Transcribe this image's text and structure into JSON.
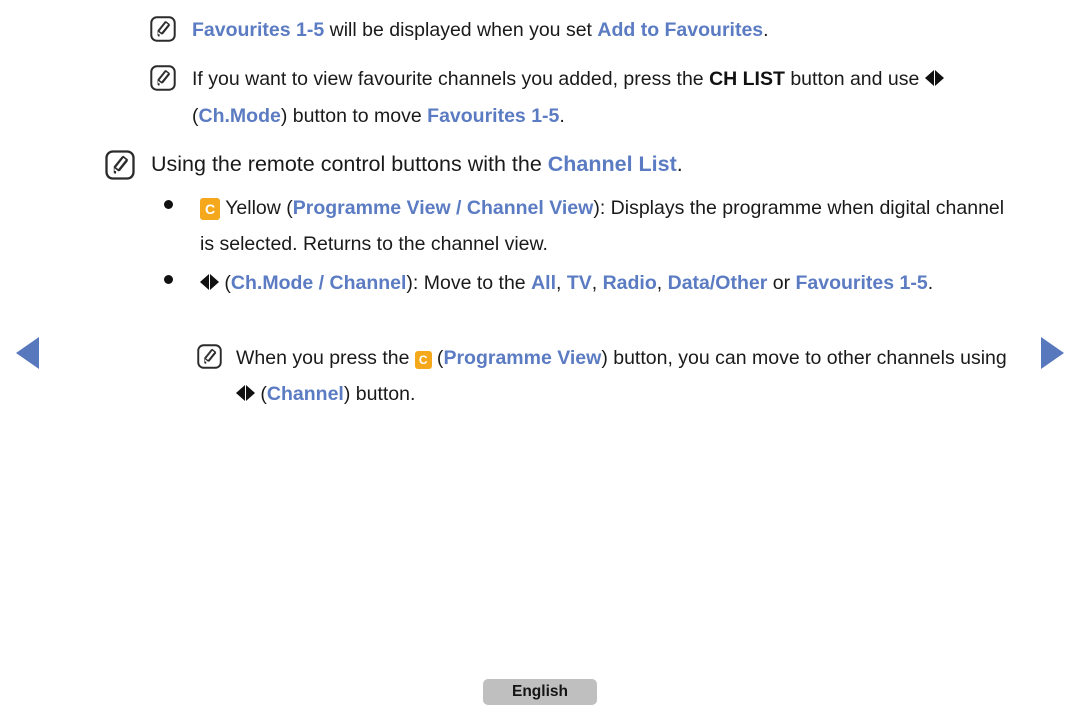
{
  "page": {
    "background": "#ffffff",
    "accent_blue": "#5B7BC2",
    "key_yellow": "#F5A81C",
    "nav_blue": "#5878BE",
    "button_grey": "#BFBFBF"
  },
  "nav": {
    "prev_label": "previous-page-arrow",
    "next_label": "next-page-arrow"
  },
  "notes": [
    {
      "icon": "note-icon",
      "segments": [
        {
          "text": "Favourites 1-5",
          "style": "blue"
        },
        {
          "text": " will be displayed when you set ",
          "style": "plain"
        },
        {
          "text": "Add to Favourites",
          "style": "blue"
        },
        {
          "text": ".",
          "style": "plain"
        }
      ]
    },
    {
      "icon": "note-icon",
      "segments": [
        {
          "text": "If you want to view favourite channels you added, press the ",
          "style": "plain"
        },
        {
          "text": "CH LIST",
          "style": "bold"
        },
        {
          "text": " button and use ",
          "style": "plain"
        },
        {
          "text": "◀▶",
          "style": "arrows"
        },
        {
          "text": " (",
          "style": "plain"
        },
        {
          "text": "Ch.Mode",
          "style": "blue"
        },
        {
          "text": ") button to move ",
          "style": "plain"
        },
        {
          "text": "Favourites 1-5",
          "style": "blue"
        },
        {
          "text": ".",
          "style": "plain"
        }
      ]
    }
  ],
  "heading": {
    "icon": "note-icon",
    "text_before": "Using the remote control buttons with the ",
    "highlight": "Channel List",
    "text_after": "."
  },
  "bullets": [
    {
      "marker": "bullet-dot",
      "badge": "C",
      "segments": [
        {
          "text": " Yellow (",
          "style": "plain"
        },
        {
          "text": "Programme View / Channel View",
          "style": "blue"
        },
        {
          "text": "): Displays the programme when digital channel is selected. Returns to the channel view.",
          "style": "plain"
        }
      ]
    },
    {
      "marker": "bullet-dot",
      "segments": [
        {
          "text": "◀▶",
          "style": "arrows"
        },
        {
          "text": " (",
          "style": "plain"
        },
        {
          "text": "Ch.Mode / Channel",
          "style": "blue"
        },
        {
          "text": "): Move to the ",
          "style": "plain"
        },
        {
          "text": "All",
          "style": "blue"
        },
        {
          "text": ", ",
          "style": "plain"
        },
        {
          "text": "TV",
          "style": "blue"
        },
        {
          "text": ", ",
          "style": "plain"
        },
        {
          "text": "Radio",
          "style": "blue"
        },
        {
          "text": ", ",
          "style": "plain"
        },
        {
          "text": "Data/Other",
          "style": "blue"
        },
        {
          "text": " or ",
          "style": "plain"
        },
        {
          "text": "Favourites 1-5",
          "style": "blue"
        },
        {
          "text": ".",
          "style": "plain"
        }
      ]
    }
  ],
  "subnote": {
    "icon": "note-icon",
    "badge": "C",
    "segments": [
      {
        "text": "When you press the ",
        "style": "plain"
      },
      {
        "text": "BADGE",
        "style": "badge"
      },
      {
        "text": " (",
        "style": "plain"
      },
      {
        "text": "Programme View",
        "style": "blue"
      },
      {
        "text": ") button, you can move to other channels using ",
        "style": "plain"
      },
      {
        "text": "◀▶",
        "style": "arrows"
      },
      {
        "text": " (",
        "style": "plain"
      },
      {
        "text": "Channel",
        "style": "blue"
      },
      {
        "text": ") button.",
        "style": "plain"
      }
    ]
  },
  "text": {
    "note1_part1": "Favourites 1-5",
    "note1_part2": " will be displayed when you set ",
    "note1_part3": "Add to Favourites",
    "note1_part4": ".",
    "note2_part1": "If you want to view favourite channels you added, press the ",
    "note2_part2": "CH LIST",
    "note2_part3": " button and use ",
    "note2_part4": " (",
    "note2_part5": "Ch.Mode",
    "note2_part6": ") button to move ",
    "note2_part7": "Favourites 1-5",
    "note2_part8": ".",
    "heading_part1": "Using the remote control buttons with the ",
    "heading_part2": "Channel List",
    "heading_part3": ".",
    "b1_badge": "C",
    "b1_part1": " Yellow (",
    "b1_part2": "Programme View / Channel View",
    "b1_part3": "): Displays the programme when digital channel is selected. Returns to the channel view.",
    "b2_part1": " (",
    "b2_part2": "Ch.Mode / Channel",
    "b2_part3": "): Move to the ",
    "b2_all": "All",
    "b2_comma1": ", ",
    "b2_tv": "TV",
    "b2_comma2": ", ",
    "b2_radio": "Radio",
    "b2_comma3": ", ",
    "b2_data": "Data/Other",
    "b2_or": " or ",
    "b2_fav": "Favourites 1-5",
    "b2_dot": ".",
    "sub_part1": "When you press the ",
    "sub_badge": "C",
    "sub_part2": " (",
    "sub_part3": "Programme View",
    "sub_part4": ") button, you can move to other channels using ",
    "sub_part5": " (",
    "sub_part6": "Channel",
    "sub_part7": ") button."
  },
  "footer": {
    "language_label": "English"
  }
}
